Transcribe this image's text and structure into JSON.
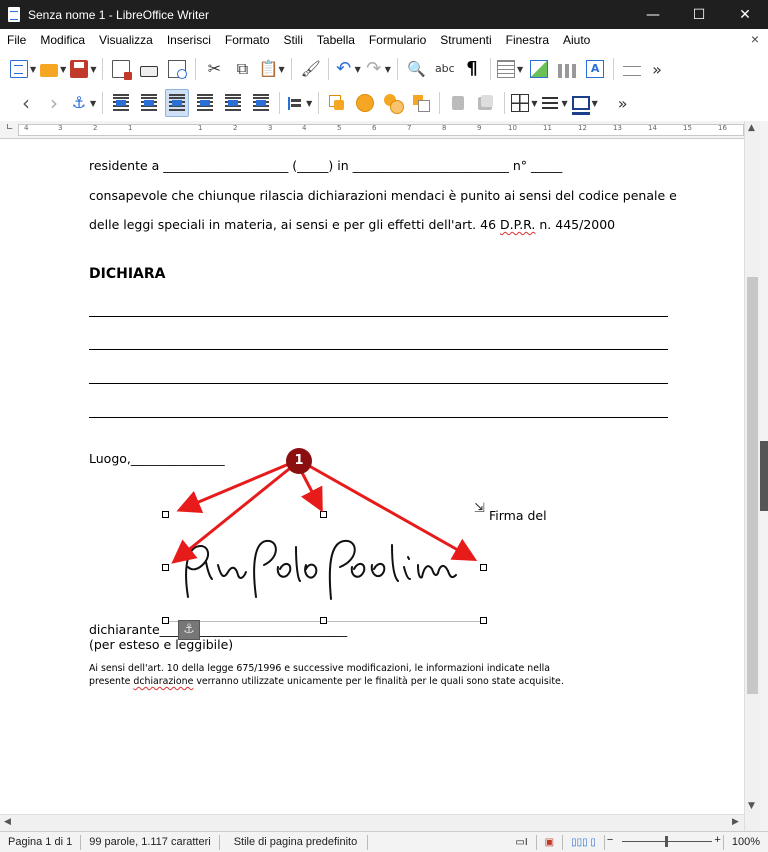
{
  "window": {
    "title": "Senza nome 1 - LibreOffice Writer",
    "minimize": "—",
    "maximize": "☐",
    "close": "✕"
  },
  "menu": {
    "items": [
      "File",
      "Modifica",
      "Visualizza",
      "Inserisci",
      "Formato",
      "Stili",
      "Tabella",
      "Formulario",
      "Strumenti",
      "Finestra",
      "Aiuto"
    ],
    "close_doc": "×"
  },
  "toolbar": {
    "more": "»",
    "spell_label": "abc",
    "pilcrow": "¶"
  },
  "ruler": {
    "ticks": [
      "4",
      "3",
      "2",
      "1",
      "1",
      "2",
      "3",
      "4",
      "5",
      "6",
      "7",
      "8",
      "9",
      "10",
      "11",
      "12",
      "13",
      "14",
      "15",
      "16"
    ]
  },
  "document": {
    "line1": "residente a ____________________ (_____) in _________________________ n° _____",
    "line2": "consapevole che chiunque rilascia dichiarazioni mendaci è punito ai sensi del codice penale e",
    "line3_before": "delle leggi speciali in materia, ai sensi e per gli effetti dell'art. 46 ",
    "line3_dpr": "D.P.R.",
    "line3_after": " n. 445/2000",
    "heading": "DICHIARA",
    "luogo": "Luogo,_______________",
    "firma": "Firma del",
    "signature": "Pier Paolo Paolini",
    "dichiarante": "dichiarante______________________________",
    "esteso": "(per esteso e leggibile)",
    "note1": "Ai sensi dell'art. 10 della legge 675/1996 e successive modificazioni, le informazioni indicate nella",
    "note2_before": "presente ",
    "note2_spell": "dchiarazione",
    "note2_after": " verranno utilizzate unicamente per le finalità per le quali sono state acquisite."
  },
  "annotation": {
    "callout_number": "1",
    "color": "#e81b1b"
  },
  "status": {
    "page": "Pagina 1 di 1",
    "words": "99 parole, 1.117 caratteri",
    "style": "Stile di pagina predefinito",
    "zoom": "100%",
    "zoom_minus": "−",
    "zoom_plus": "+"
  }
}
